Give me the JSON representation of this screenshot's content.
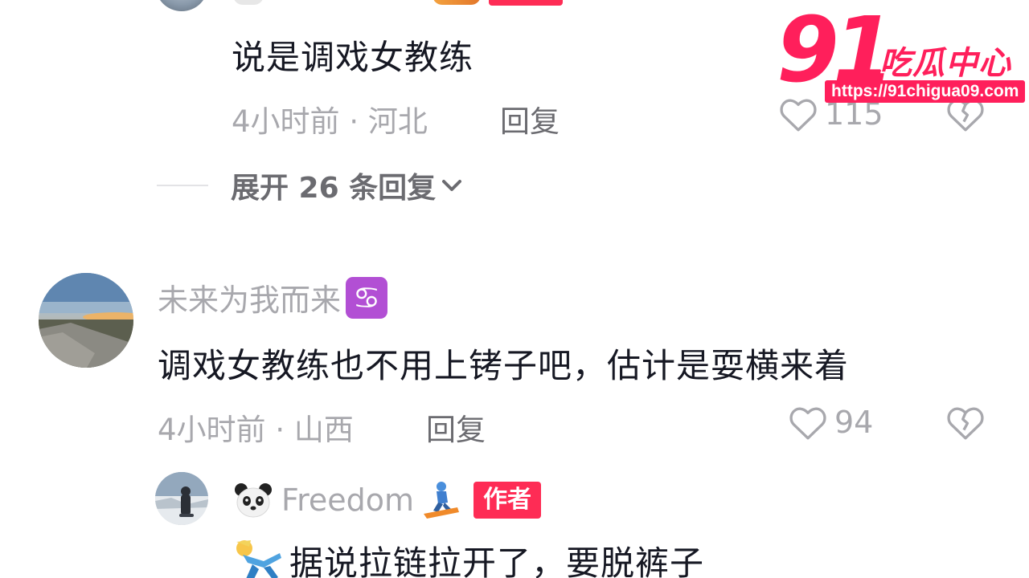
{
  "watermark": {
    "number": "91",
    "title": "吃瓜中心",
    "url": "https://91chigua09.com"
  },
  "top_comment": {
    "text": "说是调戏女教练",
    "time": "4小时前",
    "location": "河北",
    "reply_label": "回复",
    "likes": "115",
    "expand_label": "展开 26 条回复"
  },
  "main_comment": {
    "username": "未来为我而来",
    "zodiac_icon": "♋",
    "text": "调戏女教练也不用上铐子吧，估计是耍横来着",
    "time": "4小时前",
    "location": "山西",
    "reply_label": "回复",
    "likes": "94"
  },
  "author_reply": {
    "username": "Freedom",
    "badge": "作者",
    "text": "据说拉链拉开了，要脱裤子"
  },
  "colors": {
    "accent": "#fe2c55",
    "text": "#161823",
    "muted": "#a8a8ad",
    "zodiac_bg": "#b24fd4",
    "watermark": "#ff1f5b"
  }
}
